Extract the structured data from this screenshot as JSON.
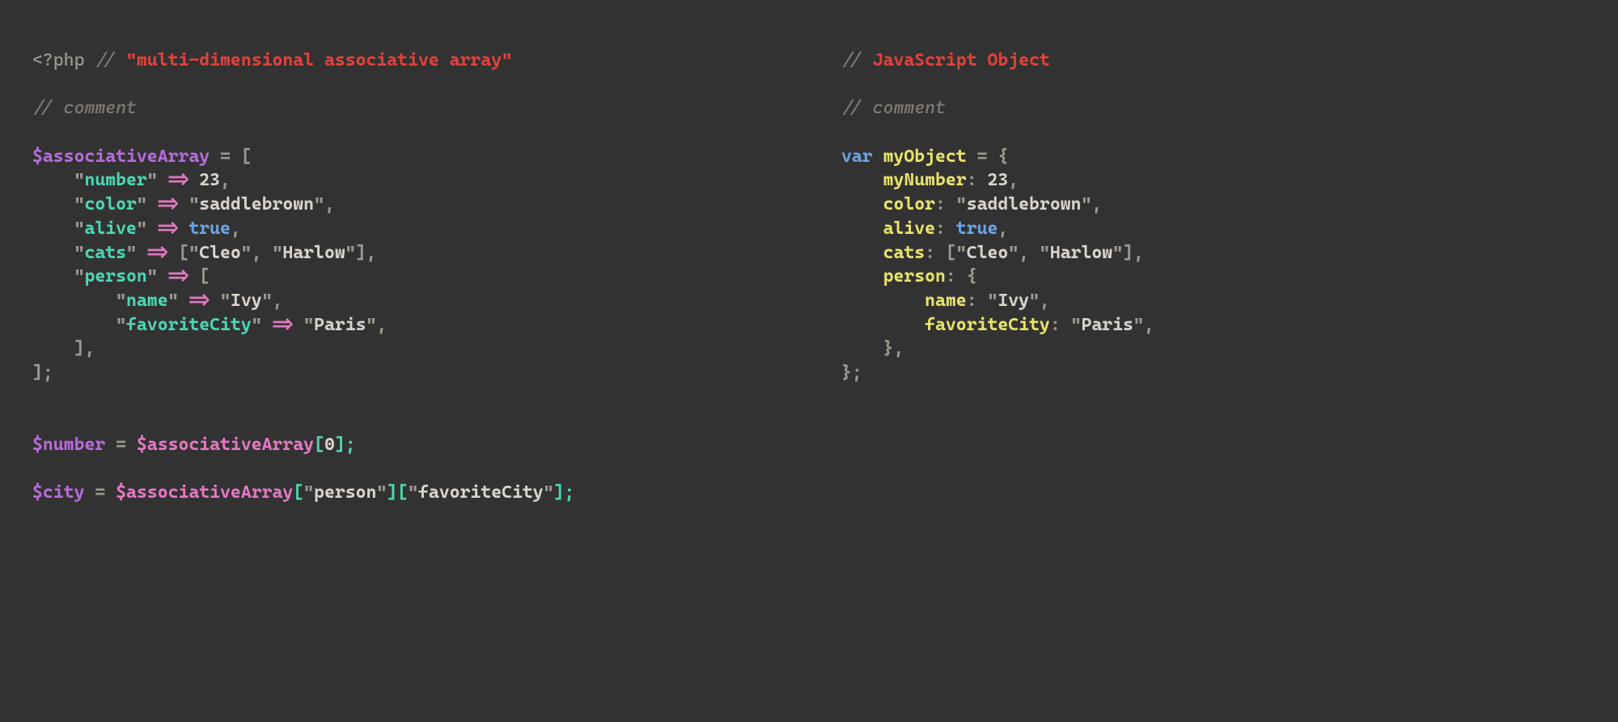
{
  "left": {
    "phpOpen": "<?php",
    "cmtSlash": "//",
    "titleQ1": "\"",
    "title": "multi-dimensional associative array",
    "titleQ2": "\"",
    "cmt2a": "//",
    "cmt2b": " comment",
    "var1": "$associativeArray",
    "eq": " = [",
    "k1q1": "\"",
    "k1": "number",
    "k1q2": "\"",
    "arrow": " => ",
    "v1": "23",
    "comma": ",",
    "k2q1": "\"",
    "k2": "color",
    "k2q2": "\"",
    "v2q1": "\"",
    "v2": "saddlebrown",
    "v2q2": "\"",
    "k3q1": "\"",
    "k3": "alive",
    "k3q2": "\"",
    "v3": "true",
    "k4q1": "\"",
    "k4": "cats",
    "k4q2": "\"",
    "arrOpen": "[",
    "c1q1": "\"",
    "c1": "Cleo",
    "c1q2": "\"",
    "c2q1": "\"",
    "c2": "Harlow",
    "c2q2": "\"",
    "arrClose": "]",
    "k5q1": "\"",
    "k5": "person",
    "k5q2": "\"",
    "pOpen": "[",
    "k6q1": "\"",
    "k6": "name",
    "k6q2": "\"",
    "v6q1": "\"",
    "v6": "Ivy",
    "v6q2": "\"",
    "k7q1": "\"",
    "k7": "favoriteCity",
    "k7q2": "\"",
    "v7q1": "\"",
    "v7": "Paris",
    "v7q2": "\"",
    "pClose": "    ],",
    "close": "];",
    "var2": "$number",
    "eq2": " = ",
    "var2r": "$associativeArray",
    "idx": "[",
    "zero": "0",
    "idx2": "];",
    "var3": "$city",
    "var3r": "$associativeArray",
    "b1": "[",
    "s1q1": "\"",
    "s1": "person",
    "s1q2": "\"",
    "b2": "][",
    "s2q1": "\"",
    "s2": "favoriteCity",
    "s2q2": "\"",
    "b3": "];"
  },
  "right": {
    "cmt1a": "//",
    "cmt1b": " ",
    "title": "JavaScript Object",
    "cmt2a": "//",
    "cmt2b": " comment",
    "kwVar": "var ",
    "obj": "myObject",
    "eq": " = {",
    "p1": "myNumber",
    "c": ": ",
    "v1": "23",
    "comma": ",",
    "p2": "color",
    "v2q1": "\"",
    "v2": "saddlebrown",
    "v2q2": "\"",
    "p3": "alive",
    "v3": "true",
    "p4": "cats",
    "arrOpen": "[",
    "c1q1": "\"",
    "c1": "Cleo",
    "c1q2": "\"",
    "c2q1": "\"",
    "c2": "Harlow",
    "c2q2": "\"",
    "arrClose": "]",
    "p5": "person",
    "brOpen": "{",
    "p6": "name",
    "v6q1": "\"",
    "v6": "Ivy",
    "v6q2": "\"",
    "p7": "favoriteCity",
    "v7q1": "\"",
    "v7": "Paris",
    "v7q2": "\"",
    "brClose": "    },",
    "close": "};"
  }
}
